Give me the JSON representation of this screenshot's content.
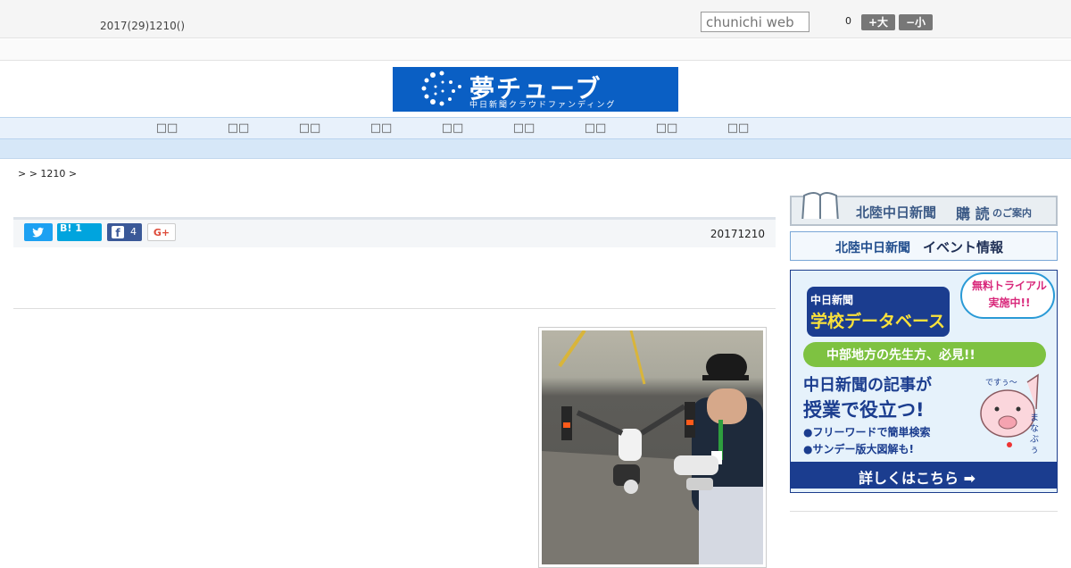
{
  "header": {
    "date": "2017(29)1210()",
    "search_placeholder": "chunichi web",
    "counter": "0",
    "font_large": "+大",
    "font_small": "−小"
  },
  "logo": {
    "title": "夢チューブ",
    "subtitle": "中日新聞クラウドファンディング"
  },
  "nav": {
    "items": [
      "□□",
      "□□",
      "□□",
      "□□",
      "□□",
      "□□",
      "□□",
      "□□",
      "□□"
    ]
  },
  "breadcrumb": ">  > 1210 >",
  "share": {
    "hatena_label": "B! 1",
    "facebook_count": "4",
    "gplus_label": "G+"
  },
  "article": {
    "date": "20171210"
  },
  "sidebar": {
    "subscribe": {
      "brand": "北陸中日新聞",
      "main": "購 読",
      "tail": "のご案内"
    },
    "event": {
      "brand": "北陸中日新聞",
      "main": "イベント情報"
    },
    "ad": {
      "org": "中日新聞",
      "product": "学校データベース",
      "trial": "無料トライアル実施中!!",
      "ribbon": "中部地方の先生方、必見!!",
      "line1": "中日新聞の記事が",
      "line2": "授業で役立つ!",
      "bullet1": "●フリーワードで簡単検索",
      "bullet2": "●サンデー版大図解も!",
      "cta": "詳しくはこちら ➡",
      "mascot_word": "ですぅ〜",
      "mascot_name": "まなぶぅ"
    }
  }
}
